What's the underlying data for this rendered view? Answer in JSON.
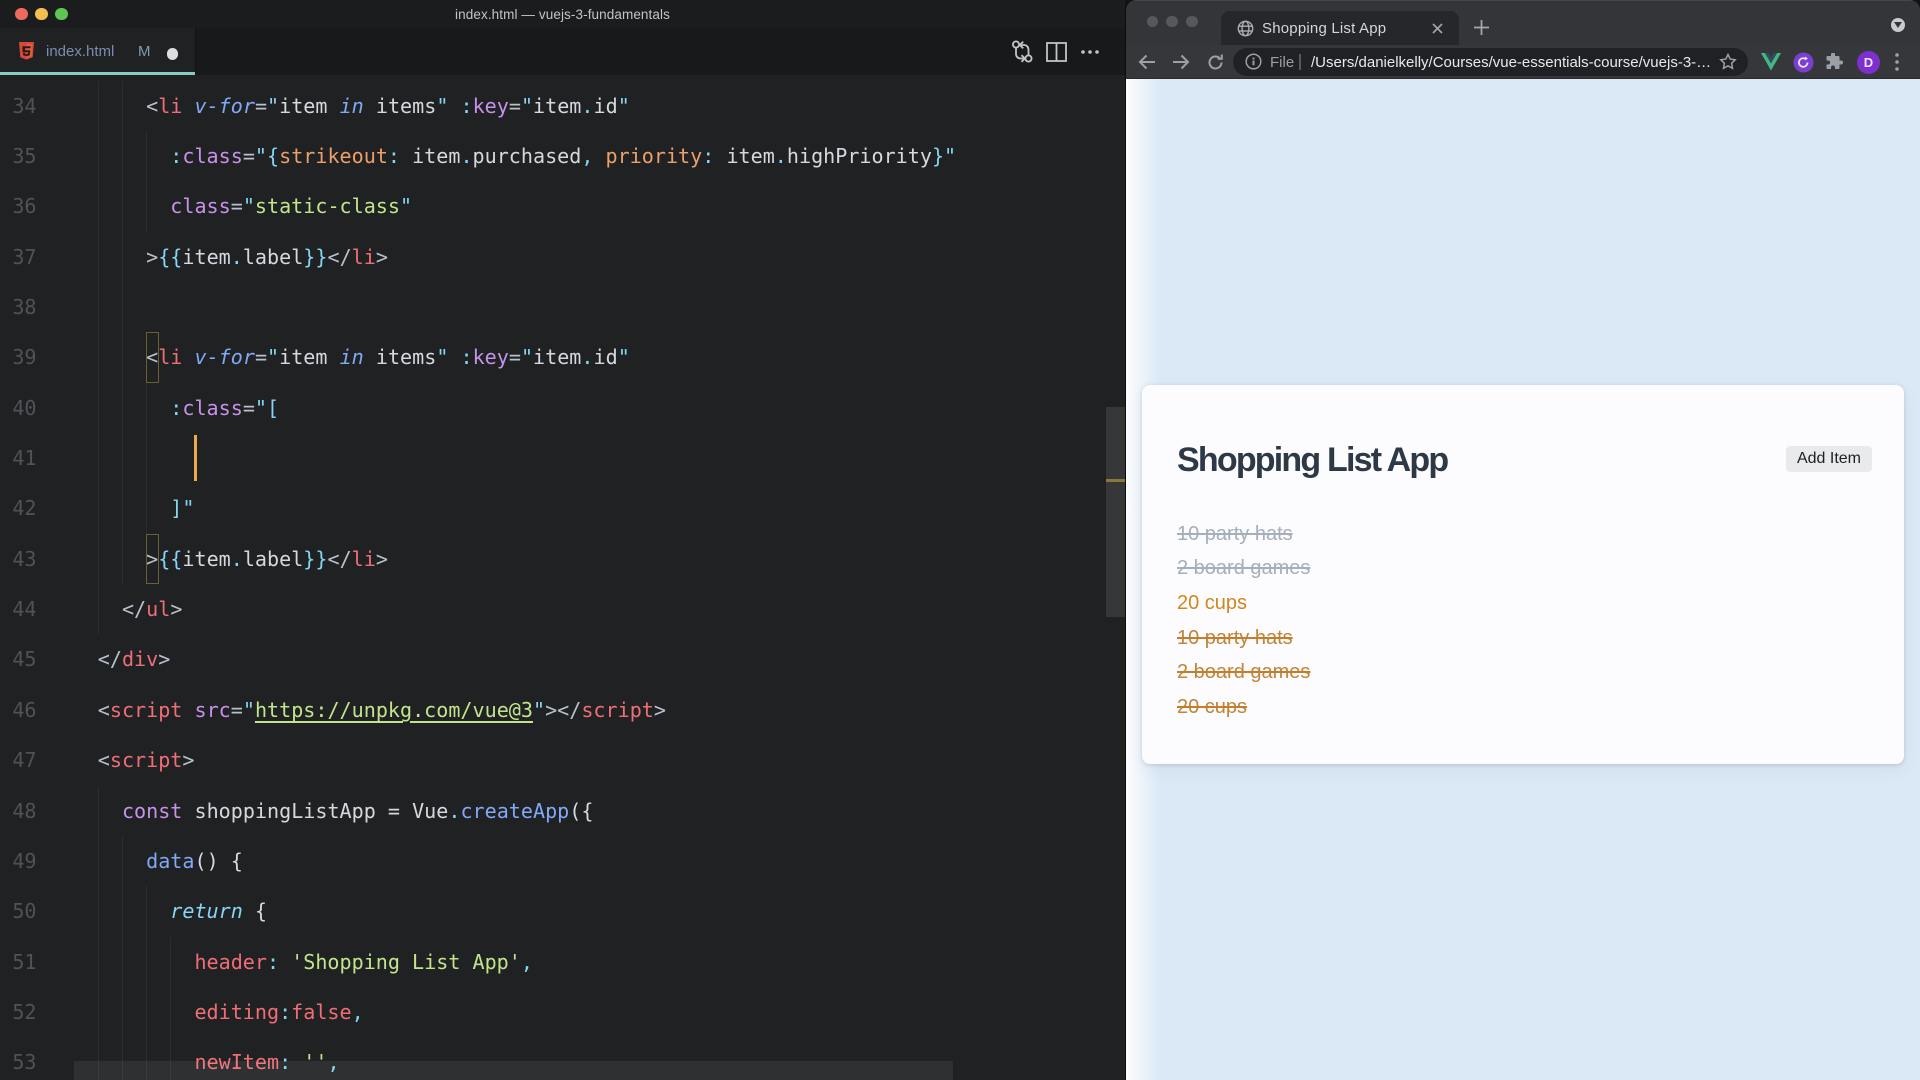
{
  "vscode": {
    "window_title": "index.html — vuejs-3-fundamentals",
    "traffic_lights": [
      "#ec6a5e",
      "#f5bf4f",
      "#61c554"
    ],
    "tab": {
      "label": "index.html",
      "git_badge": "M",
      "dirty": true
    },
    "editor_actions": [
      "open-changes-icon",
      "split-editor-icon",
      "more-actions-icon"
    ],
    "cursor": {
      "line": 41,
      "col": 10
    },
    "lines": [
      {
        "n": 34,
        "ind": 6,
        "g": [
          2,
          4
        ],
        "t": [
          [
            "<",
            "tp"
          ],
          [
            "li",
            "red"
          ],
          [
            " ",
            "w"
          ],
          [
            "v-for",
            "blueIt"
          ],
          [
            "=",
            "tp"
          ],
          [
            "\"",
            "cyan"
          ],
          [
            "item",
            "w"
          ],
          [
            " ",
            "w"
          ],
          [
            "in",
            "blueIt"
          ],
          [
            " ",
            "w"
          ],
          [
            "items",
            "w"
          ],
          [
            "\"",
            "cyan"
          ],
          [
            " ",
            "w"
          ],
          [
            ":",
            "cyan"
          ],
          [
            "key",
            "purple"
          ],
          [
            "=",
            "tp"
          ],
          [
            "\"",
            "cyan"
          ],
          [
            "item",
            "w"
          ],
          [
            ".",
            "cyan"
          ],
          [
            "id",
            "w"
          ],
          [
            "\"",
            "cyan"
          ]
        ]
      },
      {
        "n": 35,
        "ind": 8,
        "g": [
          2,
          4,
          6
        ],
        "t": [
          [
            ":",
            "cyan"
          ],
          [
            "class",
            "purple"
          ],
          [
            "=",
            "tp"
          ],
          [
            "\"",
            "cyan"
          ],
          [
            "{",
            "cyan"
          ],
          [
            "strikeout",
            "orange"
          ],
          [
            ":",
            "cyan"
          ],
          [
            " ",
            "w"
          ],
          [
            "item",
            "w"
          ],
          [
            ".",
            "cyan"
          ],
          [
            "purchased",
            "w"
          ],
          [
            ",",
            "cyan"
          ],
          [
            " ",
            "w"
          ],
          [
            "priority",
            "orange"
          ],
          [
            ":",
            "cyan"
          ],
          [
            " ",
            "w"
          ],
          [
            "item",
            "w"
          ],
          [
            ".",
            "cyan"
          ],
          [
            "highPriority",
            "w"
          ],
          [
            "}",
            "cyan"
          ],
          [
            "\"",
            "cyan"
          ]
        ]
      },
      {
        "n": 36,
        "ind": 8,
        "g": [
          2,
          4,
          6
        ],
        "t": [
          [
            "class",
            "purple"
          ],
          [
            "=",
            "tp"
          ],
          [
            "\"",
            "cyan"
          ],
          [
            "static-class",
            "green"
          ],
          [
            "\"",
            "cyan"
          ]
        ]
      },
      {
        "n": 37,
        "ind": 6,
        "g": [
          2,
          4
        ],
        "t": [
          [
            ">",
            "tp"
          ],
          [
            "{{",
            "cyan"
          ],
          [
            "item",
            "w"
          ],
          [
            ".",
            "cyan"
          ],
          [
            "label",
            "w"
          ],
          [
            "}}",
            "cyan"
          ],
          [
            "</",
            "tp"
          ],
          [
            "li",
            "red"
          ],
          [
            ">",
            "tp"
          ]
        ]
      },
      {
        "n": 38,
        "ind": 0,
        "g": [
          2,
          4
        ],
        "t": []
      },
      {
        "n": 39,
        "ind": 6,
        "g": [
          2,
          4
        ],
        "t": [
          [
            "<",
            "tp"
          ],
          [
            "li",
            "red"
          ],
          [
            " ",
            "w"
          ],
          [
            "v-for",
            "blueIt"
          ],
          [
            "=",
            "tp"
          ],
          [
            "\"",
            "cyan"
          ],
          [
            "item",
            "w"
          ],
          [
            " ",
            "w"
          ],
          [
            "in",
            "blueIt"
          ],
          [
            " ",
            "w"
          ],
          [
            "items",
            "w"
          ],
          [
            "\"",
            "cyan"
          ],
          [
            " ",
            "w"
          ],
          [
            ":",
            "cyan"
          ],
          [
            "key",
            "purple"
          ],
          [
            "=",
            "tp"
          ],
          [
            "\"",
            "cyan"
          ],
          [
            "item",
            "w"
          ],
          [
            ".",
            "cyan"
          ],
          [
            "id",
            "w"
          ],
          [
            "\"",
            "cyan"
          ]
        ]
      },
      {
        "n": 40,
        "ind": 8,
        "g": [
          2,
          4,
          6
        ],
        "t": [
          [
            ":",
            "cyan"
          ],
          [
            "class",
            "purple"
          ],
          [
            "=",
            "tp"
          ],
          [
            "\"",
            "cyan"
          ],
          [
            "[",
            "cyan"
          ]
        ]
      },
      {
        "n": 41,
        "ind": 10,
        "g": [
          2,
          4,
          6
        ],
        "t": []
      },
      {
        "n": 42,
        "ind": 8,
        "g": [
          2,
          4,
          6
        ],
        "t": [
          [
            "]",
            "cyan"
          ],
          [
            "\"",
            "cyan"
          ]
        ]
      },
      {
        "n": 43,
        "ind": 6,
        "g": [
          2,
          4
        ],
        "t": [
          [
            ">",
            "tp"
          ],
          [
            "{{",
            "cyan"
          ],
          [
            "item",
            "w"
          ],
          [
            ".",
            "cyan"
          ],
          [
            "label",
            "w"
          ],
          [
            "}}",
            "cyan"
          ],
          [
            "</",
            "tp"
          ],
          [
            "li",
            "red"
          ],
          [
            ">",
            "tp"
          ]
        ]
      },
      {
        "n": 44,
        "ind": 4,
        "g": [
          2
        ],
        "t": [
          [
            "</",
            "tp"
          ],
          [
            "ul",
            "red"
          ],
          [
            ">",
            "tp"
          ]
        ]
      },
      {
        "n": 45,
        "ind": 2,
        "g": [],
        "t": [
          [
            "</",
            "tp"
          ],
          [
            "div",
            "red"
          ],
          [
            ">",
            "tp"
          ]
        ]
      },
      {
        "n": 46,
        "ind": 2,
        "g": [],
        "t": [
          [
            "<",
            "tp"
          ],
          [
            "script",
            "red"
          ],
          [
            " ",
            "w"
          ],
          [
            "src",
            "purple"
          ],
          [
            "=",
            "tp"
          ],
          [
            "\"",
            "cyan"
          ],
          [
            "https://unpkg.com/vue@3",
            "greenU"
          ],
          [
            "\"",
            "cyan"
          ],
          [
            ">",
            "tp"
          ],
          [
            "</",
            "tp"
          ],
          [
            "script",
            "red"
          ],
          [
            ">",
            "tp"
          ]
        ]
      },
      {
        "n": 47,
        "ind": 2,
        "g": [],
        "t": [
          [
            "<",
            "tp"
          ],
          [
            "script",
            "red"
          ],
          [
            ">",
            "tp"
          ]
        ]
      },
      {
        "n": 48,
        "ind": 4,
        "g": [
          2
        ],
        "t": [
          [
            "const",
            "purple"
          ],
          [
            " ",
            "w"
          ],
          [
            "shoppingListApp",
            "w"
          ],
          [
            " ",
            "w"
          ],
          [
            "=",
            "w"
          ],
          [
            " ",
            "w"
          ],
          [
            "Vue",
            "w"
          ],
          [
            ".",
            "cyan"
          ],
          [
            "createApp",
            "blue"
          ],
          [
            "(",
            "w"
          ],
          [
            "{",
            "w"
          ]
        ]
      },
      {
        "n": 49,
        "ind": 6,
        "g": [
          2,
          4
        ],
        "t": [
          [
            "data",
            "blue"
          ],
          [
            "(",
            "w"
          ],
          [
            ")",
            "w"
          ],
          [
            " ",
            "w"
          ],
          [
            "{",
            "w"
          ]
        ]
      },
      {
        "n": 50,
        "ind": 8,
        "g": [
          2,
          4,
          6
        ],
        "t": [
          [
            "return",
            "cyanIt"
          ],
          [
            " ",
            "w"
          ],
          [
            "{",
            "w"
          ]
        ]
      },
      {
        "n": 51,
        "ind": 10,
        "g": [
          2,
          4,
          6,
          8
        ],
        "t": [
          [
            "header",
            "red"
          ],
          [
            ":",
            "cyan"
          ],
          [
            " ",
            "w"
          ],
          [
            "'Shopping List App'",
            "green"
          ],
          [
            ",",
            "cyan"
          ]
        ]
      },
      {
        "n": 52,
        "ind": 10,
        "g": [
          2,
          4,
          6,
          8
        ],
        "t": [
          [
            "editing",
            "red"
          ],
          [
            ":",
            "cyan"
          ],
          [
            "false",
            "red"
          ],
          [
            ",",
            "cyan"
          ]
        ]
      },
      {
        "n": 53,
        "ind": 10,
        "g": [
          2,
          4,
          6,
          8
        ],
        "t": [
          [
            "newItem",
            "red"
          ],
          [
            ":",
            "cyan"
          ],
          [
            " ",
            "w"
          ],
          [
            "''",
            "green"
          ],
          [
            ",",
            "cyan"
          ]
        ]
      }
    ],
    "bracket_boxes_lines": [
      39,
      43
    ]
  },
  "chrome": {
    "tab_title": "Shopping List App",
    "url_prefix": "File",
    "url": "/Users/danielkelly/Courses/vue-essentials-course/vuejs-3-…",
    "avatar_letter": "D",
    "page": {
      "heading": "Shopping List App",
      "add_button": "Add Item",
      "items": [
        {
          "label": "10 party hats",
          "purchased": true,
          "highPriority": false
        },
        {
          "label": "2 board games",
          "purchased": true,
          "highPriority": false
        },
        {
          "label": "20 cups",
          "purchased": false,
          "highPriority": true
        },
        {
          "label": "10 party hats",
          "purchased": true,
          "highPriority": true
        },
        {
          "label": "2 board games",
          "purchased": true,
          "highPriority": true
        },
        {
          "label": "20 cups",
          "purchased": true,
          "highPriority": true
        }
      ],
      "colors": {
        "background": "#dbe9f6",
        "card": "#fcfcfe",
        "heading": "#2e3947",
        "priority": "#d2861e",
        "purchased": "#a5afbb"
      }
    }
  }
}
